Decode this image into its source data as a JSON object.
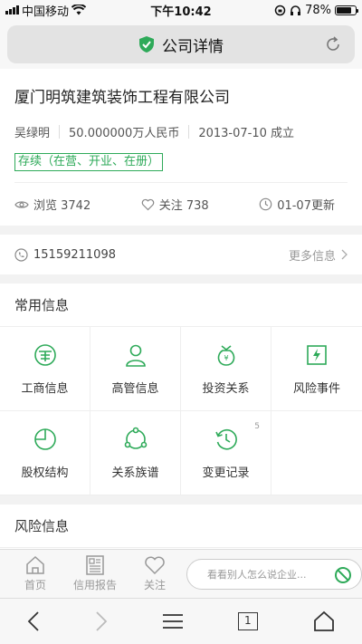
{
  "status_bar": {
    "carrier": "中国移动",
    "time": "下午10:42",
    "battery": "78%",
    "battery_level": 0.78
  },
  "address_bar": {
    "title": "公司详情"
  },
  "company": {
    "name": "厦门明筑建筑装饰工程有限公司",
    "legal_person": "吴绿明",
    "capital": "50.000000万人民币",
    "founded": "2013-07-10 成立",
    "status": "存续（在营、开业、在册）"
  },
  "stats": {
    "views": "浏览 3742",
    "follows": "关注 738",
    "updated": "01-07更新"
  },
  "contact": {
    "phone": "15159211098",
    "more": "更多信息"
  },
  "common_info": {
    "title": "常用信息",
    "items": [
      {
        "label": "工商信息",
        "icon": "business-info-icon"
      },
      {
        "label": "高管信息",
        "icon": "executive-icon"
      },
      {
        "label": "投资关系",
        "icon": "investment-icon"
      },
      {
        "label": "风险事件",
        "icon": "risk-event-icon"
      },
      {
        "label": "股权结构",
        "icon": "equity-icon"
      },
      {
        "label": "关系族谱",
        "icon": "relation-icon"
      },
      {
        "label": "变更记录",
        "icon": "change-record-icon",
        "badge": "5"
      }
    ]
  },
  "risk_info": {
    "title": "风险信息"
  },
  "bottom_nav": {
    "home": "首页",
    "credit_report": "信用报告",
    "follow": "关注",
    "comment_placeholder": "看看别人怎么说企业..."
  },
  "browser_toolbar": {
    "tab_count": "1"
  },
  "colors": {
    "accent": "#2eaa59",
    "background": "#f2f2f2"
  }
}
